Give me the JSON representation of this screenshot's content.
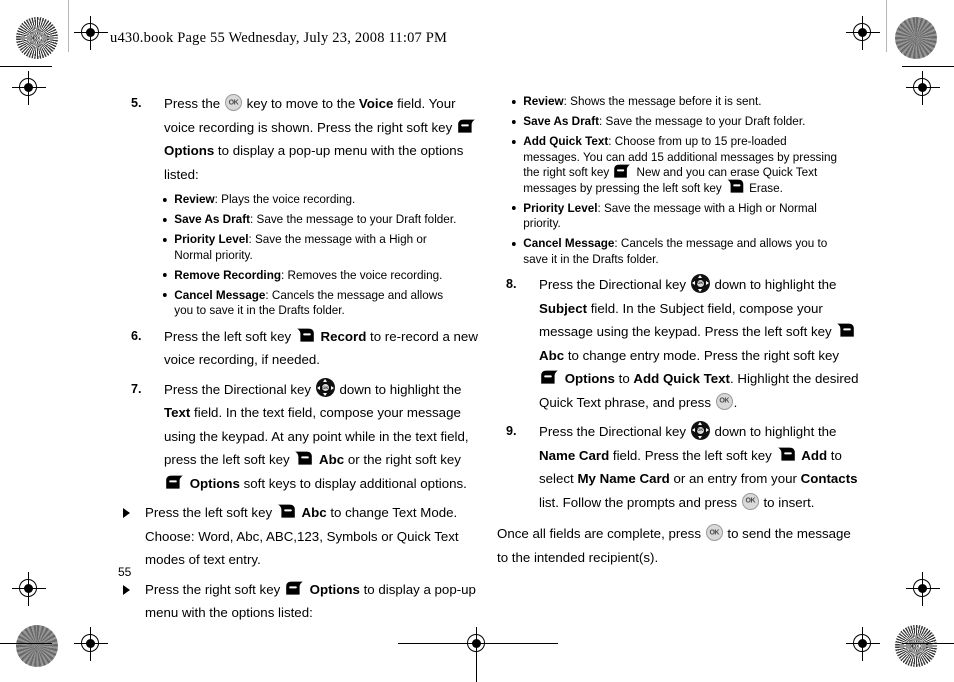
{
  "header": {
    "text": "u430.book  Page 55  Wednesday, July 23, 2008  11:07 PM"
  },
  "folio": "55",
  "left_column": [
    {
      "kind": "step",
      "number": "5.",
      "runs": [
        {
          "t": "Press the "
        },
        {
          "icon": "ok-key"
        },
        {
          "t": " key to move to the "
        },
        {
          "t": "Voice",
          "b": true
        },
        {
          "t": " field. Your voice recording is shown. Press the right soft key "
        },
        {
          "icon": "right-soft-key"
        },
        {
          "t": " "
        },
        {
          "t": "Options",
          "b": true
        },
        {
          "t": " to display a pop-up menu with the options listed:"
        }
      ]
    },
    {
      "kind": "sublist",
      "indent": "lvl1",
      "items": [
        [
          {
            "t": "Review",
            "b": true
          },
          {
            "t": ": Plays the voice recording."
          }
        ],
        [
          {
            "t": "Save As Draft",
            "b": true
          },
          {
            "t": ": Save the message to your Draft folder."
          }
        ],
        [
          {
            "t": "Priority Level",
            "b": true
          },
          {
            "t": ": Save the message with a High or Normal priority."
          }
        ],
        [
          {
            "t": "Remove Recording",
            "b": true
          },
          {
            "t": ": Removes the voice recording."
          }
        ],
        [
          {
            "t": "Cancel Message",
            "b": true
          },
          {
            "t": ": Cancels the message and allows you to save it in the Drafts folder."
          }
        ]
      ]
    },
    {
      "kind": "step",
      "number": "6.",
      "runs": [
        {
          "t": "Press the left soft key "
        },
        {
          "icon": "left-soft-key"
        },
        {
          "t": " "
        },
        {
          "t": "Record",
          "b": true
        },
        {
          "t": " to re-record a new voice recording, if needed."
        }
      ]
    },
    {
      "kind": "step",
      "number": "7.",
      "runs": [
        {
          "t": "Press the Directional key "
        },
        {
          "icon": "directional-key"
        },
        {
          "t": " down to highlight the "
        },
        {
          "t": "Text",
          "b": true
        },
        {
          "t": " field. In the text field, compose your message using the keypad. At any point while in the text field, press the left soft key "
        },
        {
          "icon": "left-soft-key"
        },
        {
          "t": " "
        },
        {
          "t": "Abc",
          "b": true
        },
        {
          "t": " or the right soft key "
        },
        {
          "icon": "right-soft-key"
        },
        {
          "t": " "
        },
        {
          "t": "Options",
          "b": true
        },
        {
          "t": " soft keys to display additional options."
        }
      ]
    },
    {
      "kind": "triangle",
      "runs": [
        {
          "t": "Press the left soft key "
        },
        {
          "icon": "left-soft-key"
        },
        {
          "t": " "
        },
        {
          "t": "Abc",
          "b": true
        },
        {
          "t": " to change Text Mode. Choose: Word, Abc, ABC,123, Symbols or Quick Text modes of text entry."
        }
      ]
    },
    {
      "kind": "triangle",
      "runs": [
        {
          "t": "Press the right soft key "
        },
        {
          "icon": "right-soft-key"
        },
        {
          "t": " "
        },
        {
          "t": "Options",
          "b": true
        },
        {
          "t": " to display a pop-up menu with the options listed:"
        }
      ]
    }
  ],
  "right_column": [
    {
      "kind": "sublist",
      "indent": "lvl2",
      "items": [
        [
          {
            "t": "Review",
            "b": true
          },
          {
            "t": ": Shows the message before it is sent."
          }
        ],
        [
          {
            "t": "Save As Draft",
            "b": true
          },
          {
            "t": ": Save the message to your Draft folder."
          }
        ],
        [
          {
            "t": "Add Quick Text",
            "b": true
          },
          {
            "t": ": Choose from up to 15 pre-loaded messages. You can add 15 additional messages by pressing the right soft key "
          },
          {
            "icon": "right-soft-key"
          },
          {
            "t": " New and you can erase Quick Text messages by pressing the left soft key "
          },
          {
            "icon": "left-soft-key"
          },
          {
            "t": " Erase."
          }
        ],
        [
          {
            "t": "Priority Level",
            "b": true
          },
          {
            "t": ": Save the message with a High or Normal priority."
          }
        ],
        [
          {
            "t": "Cancel Message",
            "b": true
          },
          {
            "t": ": Cancels the message and allows you to save it in the Drafts folder."
          }
        ]
      ]
    },
    {
      "kind": "step",
      "number": "8.",
      "runs": [
        {
          "t": "Press the Directional key "
        },
        {
          "icon": "directional-key"
        },
        {
          "t": " down to highlight the "
        },
        {
          "t": "Subject",
          "b": true
        },
        {
          "t": " field. In the Subject field, compose your message using the keypad. Press the left soft key "
        },
        {
          "icon": "left-soft-key"
        },
        {
          "t": " "
        },
        {
          "t": "Abc",
          "b": true
        },
        {
          "t": " to change entry mode. Press the right soft key "
        },
        {
          "icon": "right-soft-key"
        },
        {
          "t": " "
        },
        {
          "t": "Options",
          "b": true
        },
        {
          "t": " to "
        },
        {
          "t": "Add Quick Text",
          "b": true
        },
        {
          "t": ". Highlight the desired Quick Text phrase, and press "
        },
        {
          "icon": "ok-key"
        },
        {
          "t": "."
        }
      ]
    },
    {
      "kind": "step",
      "number": "9.",
      "runs": [
        {
          "t": "Press the Directional key "
        },
        {
          "icon": "directional-key"
        },
        {
          "t": " down to highlight the "
        },
        {
          "t": "Name Card",
          "b": true
        },
        {
          "t": " field. Press the left soft key "
        },
        {
          "icon": "left-soft-key"
        },
        {
          "t": " "
        },
        {
          "t": "Add",
          "b": true
        },
        {
          "t": " to select "
        },
        {
          "t": "My Name Card",
          "b": true
        },
        {
          "t": " or an entry from your "
        },
        {
          "t": "Contacts",
          "b": true
        },
        {
          "t": " list. Follow the prompts and press "
        },
        {
          "icon": "ok-key"
        },
        {
          "t": " to insert."
        }
      ]
    },
    {
      "kind": "plain",
      "runs": [
        {
          "t": "Once all fields are complete, press "
        },
        {
          "icon": "ok-key"
        },
        {
          "t": " to send the message to the intended recipient(s)."
        }
      ]
    }
  ],
  "icons": {
    "ok-key": "ok-key-icon",
    "directional-key": "directional-key-icon",
    "left-soft-key": "left-soft-key-icon",
    "right-soft-key": "right-soft-key-icon"
  },
  "colors": {
    "text": "#000000",
    "page": "#ffffff",
    "ok_key_fill": "#d9d9d9",
    "dir_key_fill": "#111111"
  }
}
